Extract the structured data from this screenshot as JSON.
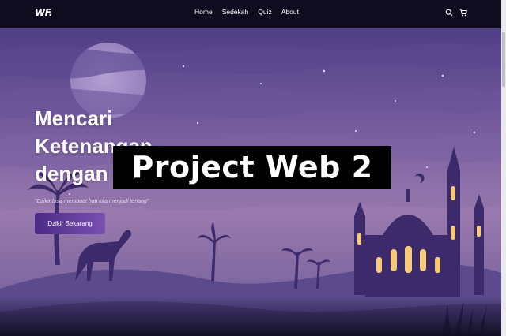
{
  "navbar": {
    "logo": "WF.",
    "links": [
      "Home",
      "Sedekah",
      "Quiz",
      "About"
    ],
    "icons": [
      "search-icon",
      "cart-icon"
    ]
  },
  "hero": {
    "headline": [
      "Mencari",
      "Ketenangan",
      "dengan"
    ],
    "subtext": "\"Dzikir bisa membuat hati kita menjadi tenang\"",
    "cta_label": "Dzikir Sekarang"
  },
  "overlay_title": "Project Web 2",
  "colors": {
    "nav_bg": "#0e0c1e",
    "sky_top": "#5a4a8f",
    "sky_mid": "#8a6ba8",
    "dune": "#5b4a8c",
    "silhouette": "#3d2a6b",
    "window_glow": "#f7c97a",
    "button_start": "#4b2b86",
    "button_end": "#7a4fb0",
    "overlay_bg": "#000000"
  }
}
